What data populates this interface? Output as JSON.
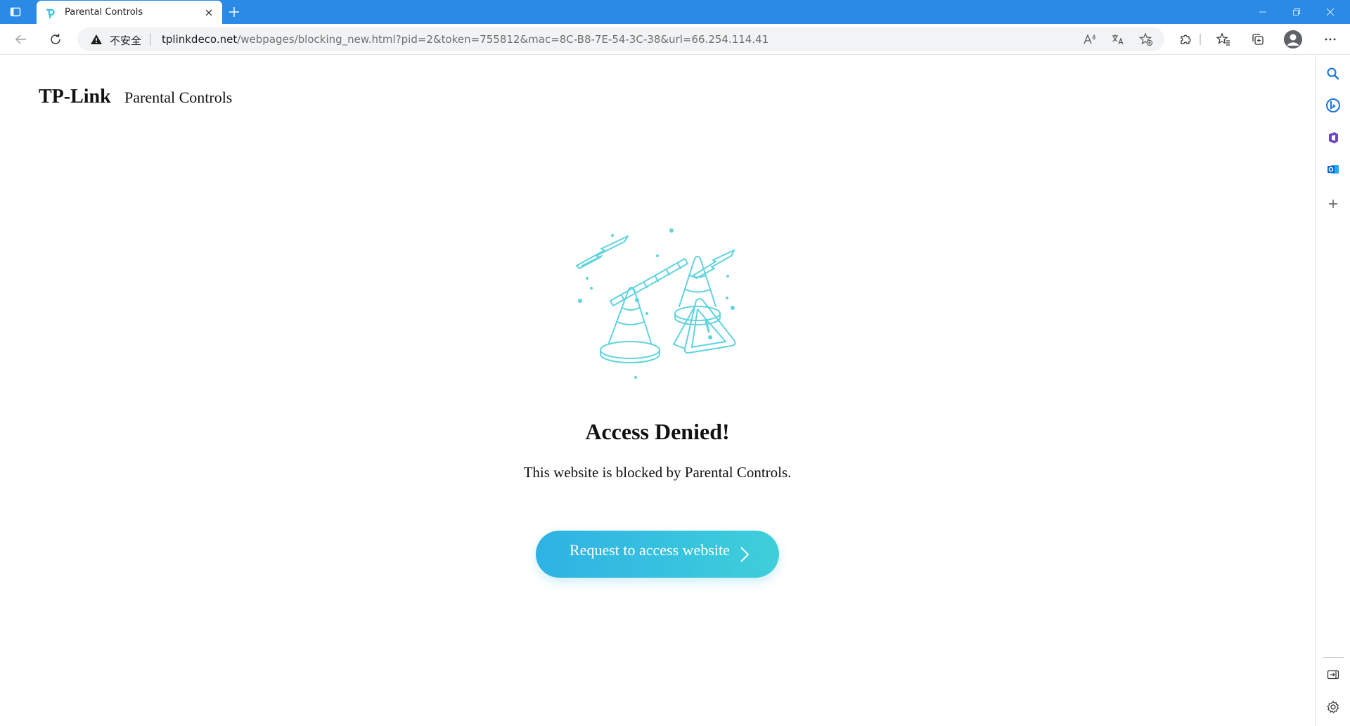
{
  "browser": {
    "tab": {
      "title": "Parental Controls",
      "favicon": "tp-link-logo-icon"
    },
    "omnibox": {
      "security_label": "不安全",
      "url_host": "tplinkdeco.net",
      "url_path": "/webpages/blocking_new.html?pid=2&token=755812&mac=8C-B8-7E-54-3C-38&url=66.254.114.41"
    },
    "colors": {
      "tabbar": "#2b8ae5",
      "omnibox_bg": "#f1f3f4"
    }
  },
  "page": {
    "brand": "TP-Link",
    "brand_sub": "Parental Controls",
    "heading": "Access Denied!",
    "message": "This website is blocked by Parental Controls.",
    "request_button": "Request to access website",
    "illustration": "traffic-cones-warning-illustration",
    "colors": {
      "accent_start": "#2eb2e4",
      "accent_end": "#3fcfda",
      "illustration_stroke": "#5fd3df"
    }
  }
}
